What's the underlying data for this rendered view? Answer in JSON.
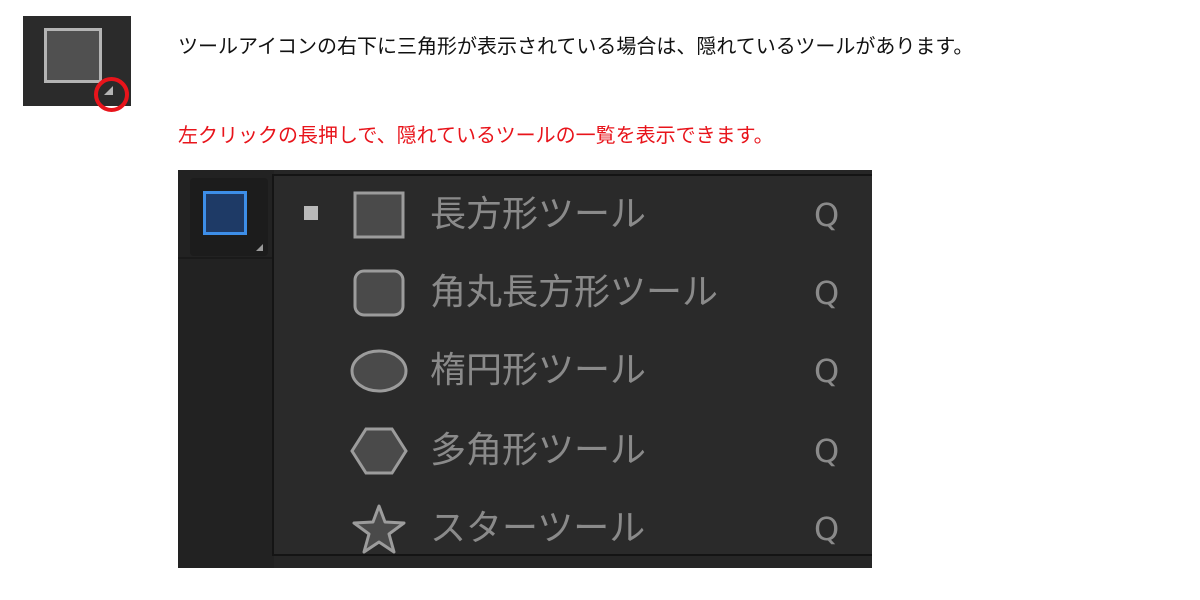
{
  "description": {
    "hidden_tool_note": "ツールアイコンの右下に三角形が表示されている場合は、隠れているツールがあります。",
    "long_press_note": "左クリックの長押しで、隠れているツールの一覧を表示できます。"
  },
  "colors": {
    "highlight": "#e8141b",
    "active_tool_border": "#3d8ee8",
    "menu_text": "#8a8a8a"
  },
  "flyout": {
    "items": [
      {
        "icon": "rectangle-icon",
        "label": "長方形ツール",
        "shortcut": "Q",
        "selected": true
      },
      {
        "icon": "rounded-rectangle-icon",
        "label": "角丸長方形ツール",
        "shortcut": "Q",
        "selected": false
      },
      {
        "icon": "ellipse-icon",
        "label": "楕円形ツール",
        "shortcut": "Q",
        "selected": false
      },
      {
        "icon": "polygon-icon",
        "label": "多角形ツール",
        "shortcut": "Q",
        "selected": false
      },
      {
        "icon": "star-icon",
        "label": "スターツール",
        "shortcut": "Q",
        "selected": false
      }
    ]
  }
}
